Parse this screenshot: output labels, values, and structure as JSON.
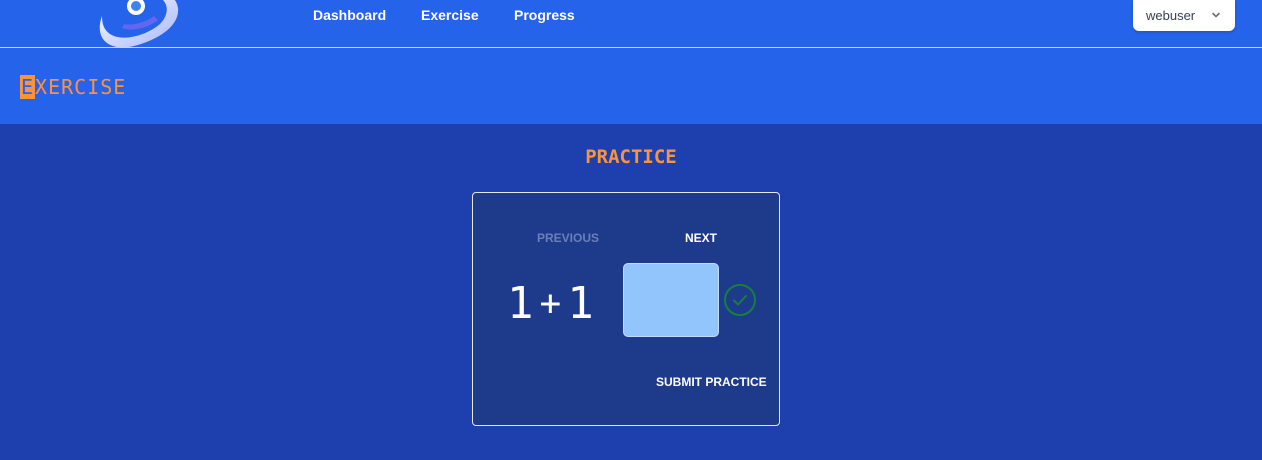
{
  "nav": {
    "links": [
      "Dashboard",
      "Exercise",
      "Progress"
    ],
    "user": {
      "name": "webuser"
    }
  },
  "page": {
    "title_initial": "E",
    "title_rest": "XERCISE"
  },
  "practice": {
    "heading": "PRACTICE",
    "previous_label": "PREVIOUS",
    "next_label": "NEXT",
    "operand_a": "1",
    "operator": "+",
    "operand_b": "1",
    "answer_value": "",
    "submit_label": "SUBMIT PRACTICE",
    "status_icon": "check-circle-icon"
  },
  "colors": {
    "brand_blue": "#2563eb",
    "background": "#1e40af",
    "accent_orange": "#fb923c",
    "input_fill": "#93c5fd",
    "success_green": "#15803d"
  }
}
